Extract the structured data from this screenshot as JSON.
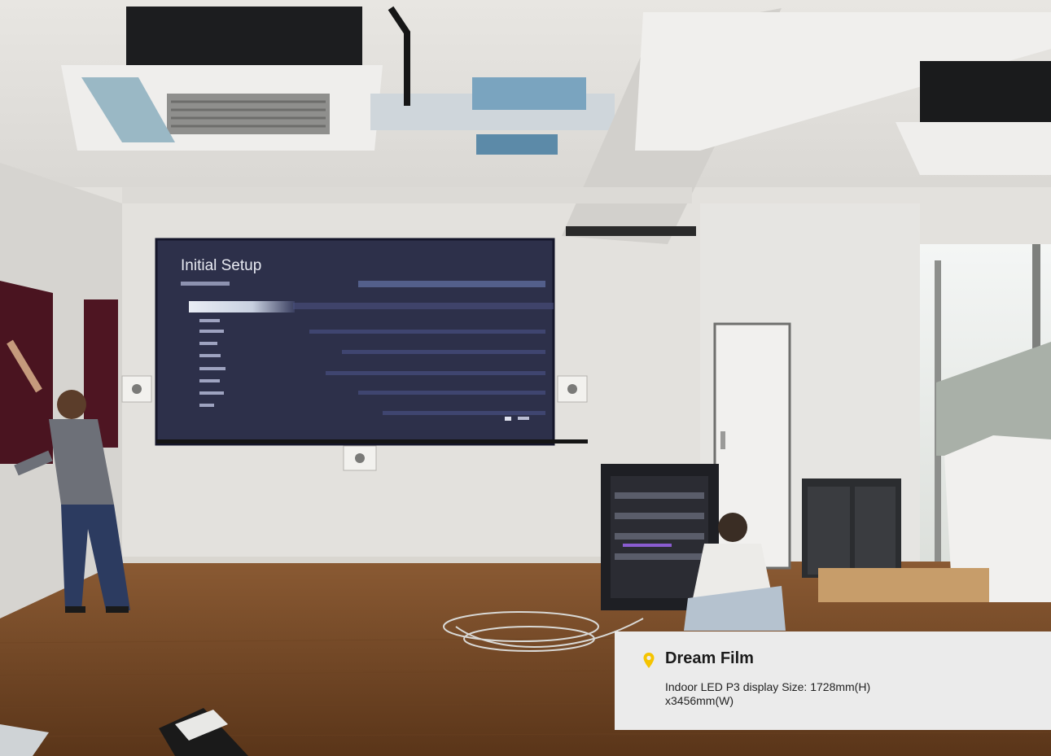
{
  "screen": {
    "title": "Initial Setup",
    "languages": [
      "",
      "",
      "",
      "",
      "",
      "",
      "",
      "",
      "",
      ""
    ]
  },
  "caption": {
    "title": "Dream Film",
    "description": "Indoor LED P3 display  Size: 1728mm(H) x3456mm(W)",
    "pin_icon": "location-pin-icon",
    "pin_color": "#f5c400"
  }
}
